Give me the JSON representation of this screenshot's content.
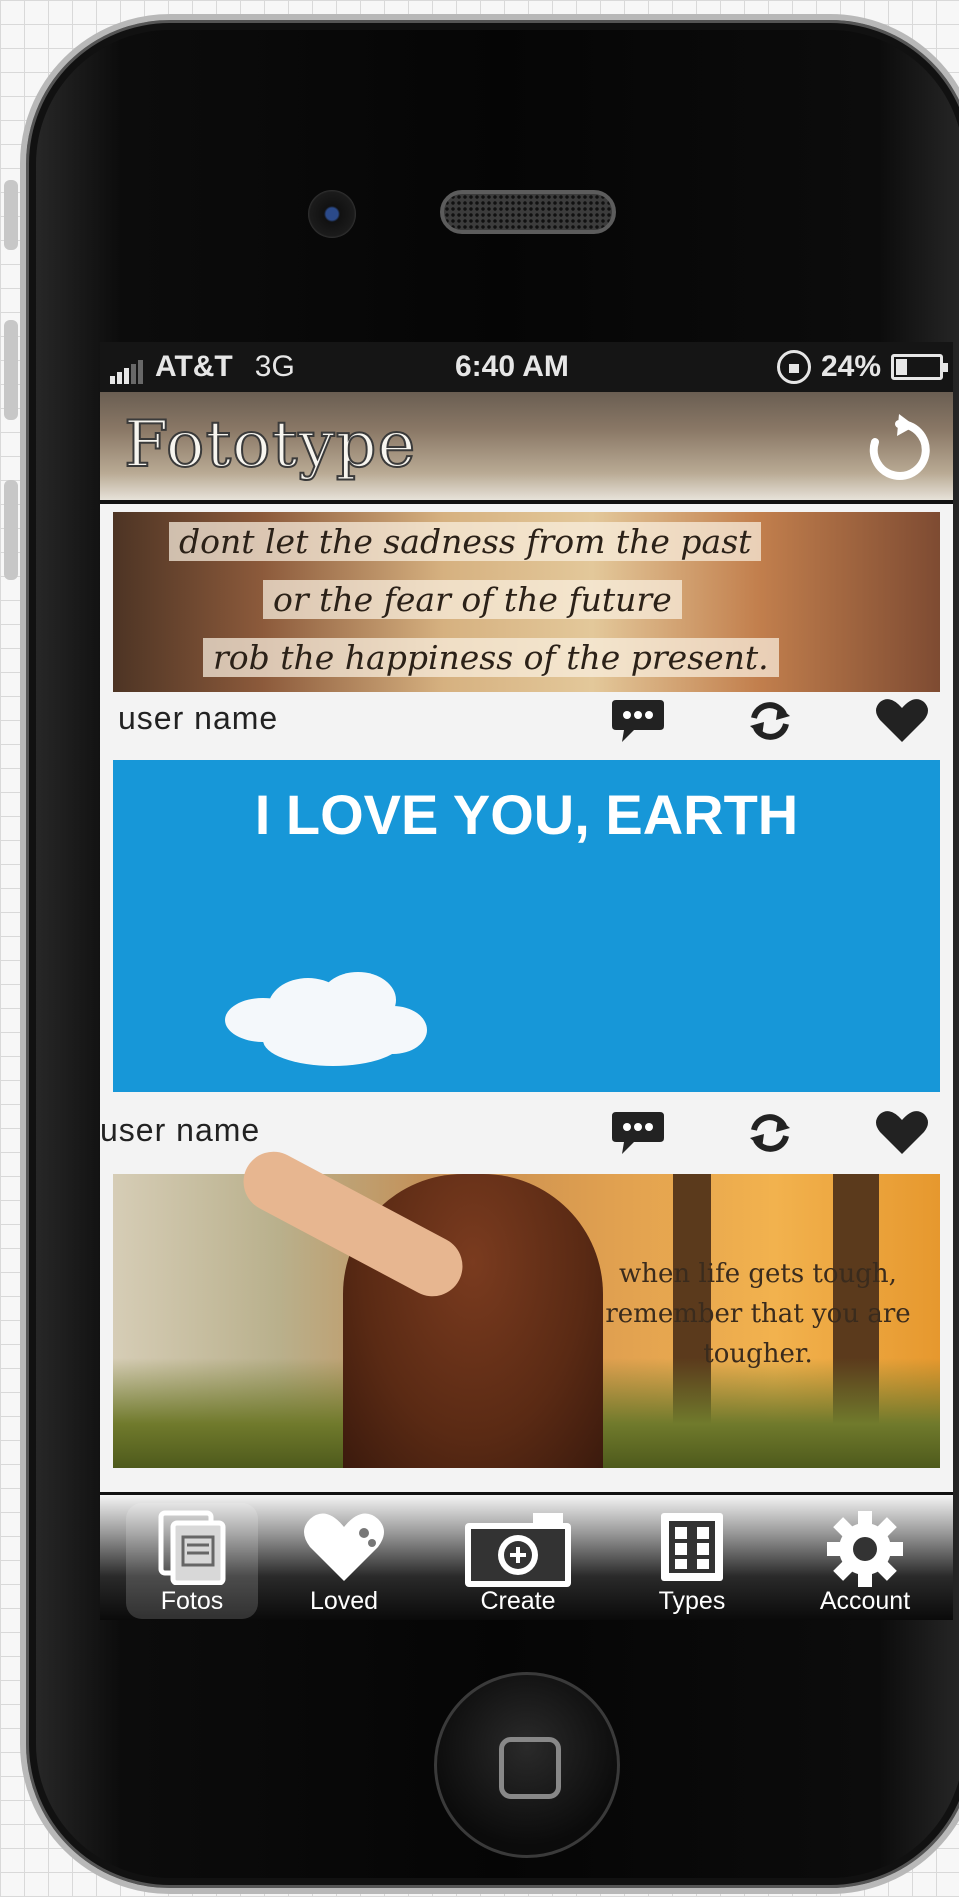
{
  "status_bar": {
    "carrier": "AT&T",
    "network": "3G",
    "time": "6:40 AM",
    "battery": "24%",
    "battery_level": 0.24
  },
  "nav": {
    "title": "Fototype",
    "refresh_icon": "refresh-icon"
  },
  "feed": {
    "posts": [
      {
        "image_text_lines": [
          "dont let the sadness from the past",
          "or the fear of the future",
          "rob the happiness of the present."
        ],
        "username": "user name"
      },
      {
        "image_text": "I LOVE YOU, EARTH",
        "username": "user name"
      },
      {
        "image_text": "when life gets tough, remember that you are tougher."
      }
    ],
    "action_icons": [
      "comment-icon",
      "repost-icon",
      "heart-icon"
    ]
  },
  "tabbar": {
    "tabs": [
      {
        "label": "Fotos",
        "icon": "photos-icon",
        "active": true
      },
      {
        "label": "Loved",
        "icon": "heart-icon",
        "active": false
      },
      {
        "label": "Create",
        "icon": "camera-icon",
        "active": false
      },
      {
        "label": "Types",
        "icon": "grid-icon",
        "active": false
      },
      {
        "label": "Account",
        "icon": "gear-icon",
        "active": false
      }
    ]
  },
  "colors": {
    "accent_blue": "#1797d8",
    "tabbar_dark": "#0a0a0a",
    "screen_bg": "#f3f3f3"
  }
}
